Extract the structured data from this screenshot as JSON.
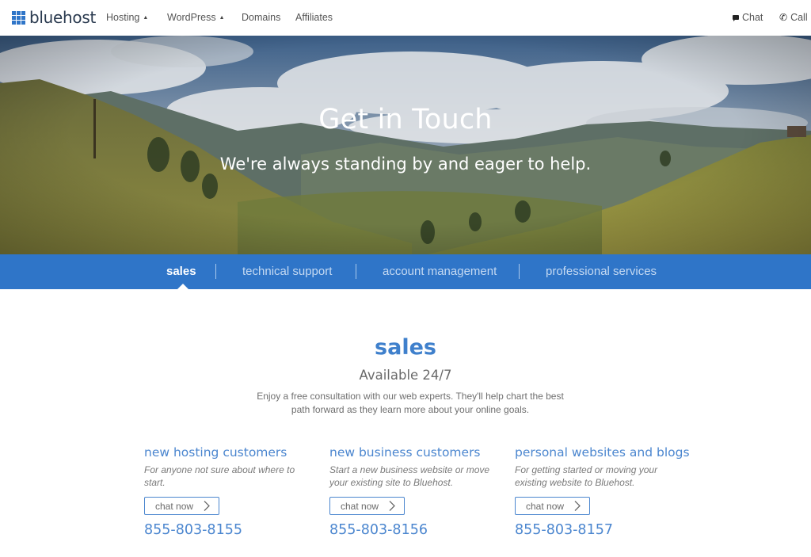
{
  "brand": {
    "name": "bluehost",
    "accent": "#2f75c8"
  },
  "nav": {
    "items": [
      {
        "label": "Hosting",
        "has_dropdown": true
      },
      {
        "label": "WordPress",
        "has_dropdown": true
      },
      {
        "label": "Domains",
        "has_dropdown": false
      },
      {
        "label": "Affiliates",
        "has_dropdown": false
      }
    ],
    "utility": {
      "chat_label": "Chat",
      "chat_icon": "chat-bubble-icon",
      "call_label": "Call",
      "call_icon": "phone-icon"
    }
  },
  "hero": {
    "title": "Get in Touch",
    "subtitle": "We're always standing by and eager to help."
  },
  "tabs": [
    {
      "label": "sales",
      "active": true
    },
    {
      "label": "technical support",
      "active": false
    },
    {
      "label": "account management",
      "active": false
    },
    {
      "label": "professional services",
      "active": false
    }
  ],
  "section": {
    "title": "sales",
    "subtitle": "Available 24/7",
    "description": "Enjoy a free consultation with our web experts. They'll help chart the best path forward as they learn more about your online goals."
  },
  "columns": [
    {
      "title": "new hosting customers",
      "description": "For anyone not sure about where to start.",
      "button_label": "chat now",
      "phone": "855-803-8155"
    },
    {
      "title": "new business customers",
      "description": "Start a new business website or move your existing site to Bluehost.",
      "button_label": "chat now",
      "phone": "855-803-8156"
    },
    {
      "title": "personal websites and blogs",
      "description": "For getting started or moving your existing website to Bluehost.",
      "button_label": "chat now",
      "phone": "855-803-8157"
    }
  ]
}
